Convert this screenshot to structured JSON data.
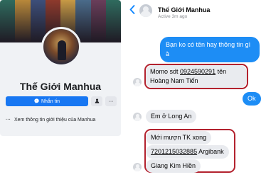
{
  "facebook_page": {
    "name": "Thế Giới Manhua",
    "message_button": "Nhắn tin",
    "more_button": "···",
    "about_link": "Xem thông tin giới thiệu của Manhua",
    "about_dots": "···",
    "cover_colors": [
      "#2f6b5e",
      "#b8883a",
      "#3d4f7a",
      "#8e3a2c",
      "#c79a45",
      "#4a6b8a",
      "#6a3e5a",
      "#2f6b5e"
    ]
  },
  "chat": {
    "contact_name": "Thế Giới Manhua",
    "contact_status": "Active 3m ago",
    "messages": [
      {
        "from": "me",
        "text": "Bạn ko có tên hay thông tin gì à"
      },
      {
        "from": "them",
        "text_before": "Momo sdt ",
        "number": "0924590291",
        "text_after": " tên",
        "line2": "Hoàng Nam Tiến"
      },
      {
        "from": "me",
        "text": "Ok"
      },
      {
        "from": "them",
        "text": "Em ở Long An"
      },
      {
        "from": "them",
        "text": "Mới mượn TK xong"
      },
      {
        "from": "them",
        "account": "7201215032885",
        "bank": " Argibank"
      },
      {
        "from": "them",
        "text": "Giang Kim Hiền"
      }
    ]
  },
  "colors": {
    "messenger_blue": "#1d8df5",
    "facebook_blue": "#1877f2",
    "highlight_red": "#b3222e",
    "incoming_bubble": "#e9ebef"
  }
}
